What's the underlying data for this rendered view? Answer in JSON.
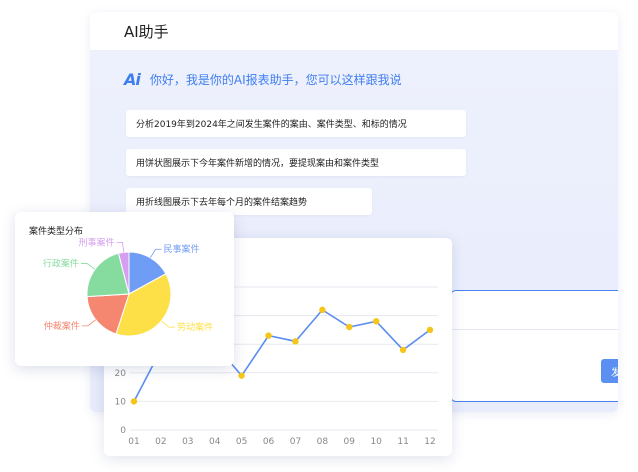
{
  "window": {
    "title": "AI助手"
  },
  "greeting": {
    "logo": "Ai",
    "text": "你好，我是你的AI报表助手，您可以这样跟我说"
  },
  "suggestions": [
    "分析2019年到2024年之间发生案件的案由、案件类型、和标的情况",
    "用饼状图展示下今年案件新增的情况，要提现案由和案件类型",
    "用折线图展示下去年每个月的案件结案趋势"
  ],
  "input": {
    "send_label": "发送"
  },
  "colors": {
    "accent": "#3f7ef0",
    "line": "#5b8def",
    "point": "#f5c518"
  },
  "chart_data": [
    {
      "type": "line",
      "categories": [
        "01",
        "02",
        "03",
        "04",
        "05",
        "06",
        "07",
        "08",
        "09",
        "10",
        "11",
        "12"
      ],
      "values": [
        10,
        28,
        31,
        30,
        19,
        33,
        31,
        42,
        36,
        38,
        28,
        35
      ],
      "yticks": [
        0,
        10,
        20
      ],
      "ylim": [
        0,
        50
      ]
    },
    {
      "type": "pie",
      "title": "案件类型分布",
      "slices": [
        {
          "label": "民事案件",
          "value": 17,
          "color": "#6f9cf4"
        },
        {
          "label": "劳动案件",
          "value": 38,
          "color": "#fde047"
        },
        {
          "label": "仲裁案件",
          "value": 19,
          "color": "#f58670"
        },
        {
          "label": "行政案件",
          "value": 22,
          "color": "#86dc9f"
        },
        {
          "label": "刑事案件",
          "value": 4,
          "color": "#d59ef0"
        }
      ]
    }
  ]
}
